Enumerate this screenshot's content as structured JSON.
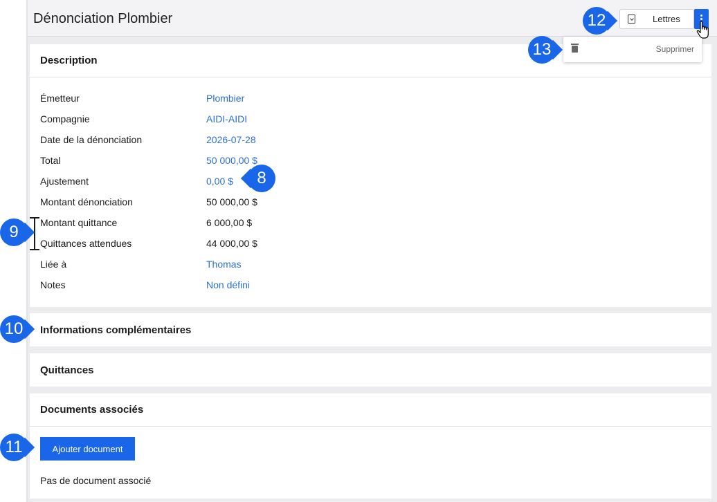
{
  "header": {
    "title": "Dénonciation Plombier",
    "lettres_label": "Lettres"
  },
  "dropdown": {
    "delete_label": "Supprimer"
  },
  "description": {
    "title": "Description",
    "rows": [
      {
        "key": "Émetteur",
        "value": "Plombier"
      },
      {
        "key": "Compagnie",
        "value": "AIDI-AIDI"
      },
      {
        "key": "Date de la dénonciation",
        "value": "2026-07-28"
      },
      {
        "key": "Total",
        "value": "50 000,00 $"
      },
      {
        "key": "Ajustement",
        "value": "0,00 $"
      },
      {
        "key": "Montant dénonciation",
        "value": "50 000,00 $"
      },
      {
        "key": "Montant quittance",
        "value": "6 000,00 $"
      },
      {
        "key": "Quittances attendues",
        "value": "44 000,00 $"
      },
      {
        "key": "Liée à",
        "value": "Thomas"
      },
      {
        "key": "Notes",
        "value": "Non défini"
      }
    ]
  },
  "sections": {
    "info_title": "Informations complémentaires",
    "quittances_title": "Quittances",
    "documents_title": "Documents associés"
  },
  "documents": {
    "add_label": "Ajouter document",
    "empty_text": "Pas de document associé"
  },
  "callouts": {
    "c8": "8",
    "c9": "9",
    "c10": "10",
    "c11": "11",
    "c12": "12",
    "c13": "13"
  },
  "colors": {
    "accent": "#1a66e8",
    "link": "#2b6fd6"
  },
  "icons": [
    "document-download-icon",
    "more-vertical-icon",
    "trash-icon",
    "hand-pointer-icon"
  ]
}
